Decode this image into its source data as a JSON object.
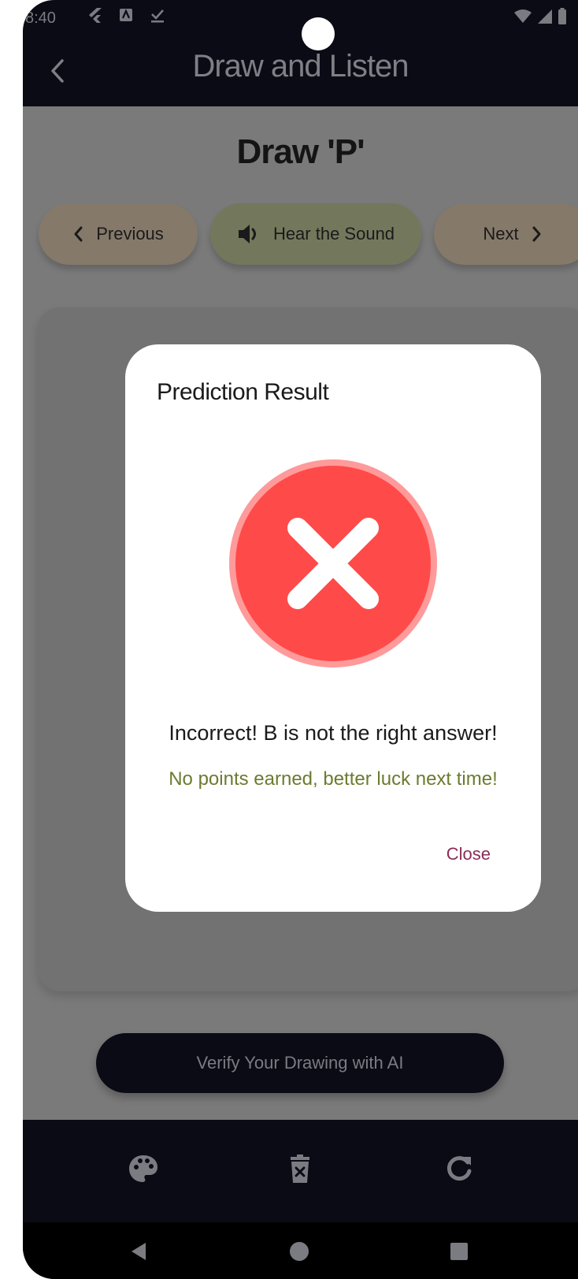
{
  "status_bar": {
    "time": "8:40"
  },
  "app_bar": {
    "title": "Draw and Listen"
  },
  "screen": {
    "heading": "Draw 'P'"
  },
  "controls": {
    "previous_label": "Previous",
    "sound_label": "Hear the Sound",
    "next_label": "Next"
  },
  "verify": {
    "label": "Verify Your Drawing with AI"
  },
  "toolbar": {
    "icons": [
      "palette-icon",
      "delete-icon",
      "refresh-icon"
    ]
  },
  "dialog": {
    "title": "Prediction Result",
    "message": "Incorrect! B is not the right answer!",
    "submessage": "No points earned, better luck next time!",
    "close_label": "Close",
    "status_icon": "error-x-icon"
  },
  "colors": {
    "appbar": "#0b0b16",
    "error_red": "#ff4a4a",
    "sub_text": "#6b7b2f",
    "close_text": "#8a2e55"
  }
}
